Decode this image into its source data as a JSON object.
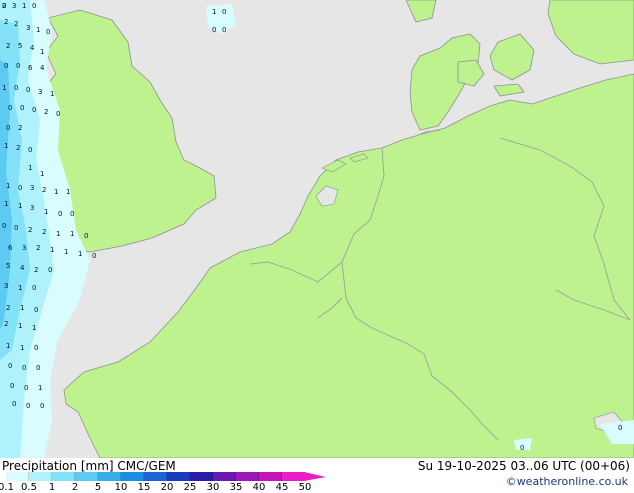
{
  "footer": {
    "title": "Precipitation [mm]  CMC/GEM",
    "time": "Su 19-10-2025 03..06 UTC (00+06)",
    "credit": "©weatheronline.co.uk"
  },
  "legend": {
    "ticks": [
      "0.1",
      "0.5",
      "1",
      "2",
      "5",
      "10",
      "15",
      "20",
      "25",
      "30",
      "35",
      "40",
      "45",
      "50"
    ],
    "colors": [
      "#d8fcff",
      "#b0f2fc",
      "#84e2f8",
      "#5ccaf2",
      "#36aeea",
      "#1a8ee0",
      "#1c64d2",
      "#1c3cbe",
      "#2a1ea8",
      "#6a1ab0",
      "#9c16b8",
      "#c614bc",
      "#e81cc8"
    ]
  },
  "map_colors": {
    "sea": "#e6e6e6",
    "land": "#bdf28e",
    "border": "#a0a0a0",
    "coast": "#909090"
  },
  "precip_labels": [
    "2",
    "3",
    "1",
    "0",
    "2",
    "2",
    "3",
    "1",
    "0",
    "2",
    "5",
    "4",
    "1",
    "0",
    "0",
    "6",
    "4",
    "1",
    "0",
    "0",
    "3",
    "1",
    "0",
    "0",
    "0",
    "2",
    "0",
    "0",
    "2",
    "0",
    "1",
    "2",
    "1",
    "1",
    "1",
    "0",
    "3",
    "2",
    "1",
    "1",
    "1",
    "1",
    "3",
    "1",
    "0",
    "0",
    "0",
    "0",
    "2",
    "2",
    "1",
    "1",
    "0",
    "6",
    "3",
    "2",
    "1",
    "1",
    "1",
    "0",
    "5",
    "4",
    "2",
    "0",
    "3",
    "1",
    "0",
    "2",
    "1",
    "0",
    "2",
    "1",
    "1",
    "1",
    "1",
    "0",
    "0",
    "0",
    "0",
    "0",
    "0",
    "1",
    "0",
    "0",
    "0",
    "0"
  ]
}
